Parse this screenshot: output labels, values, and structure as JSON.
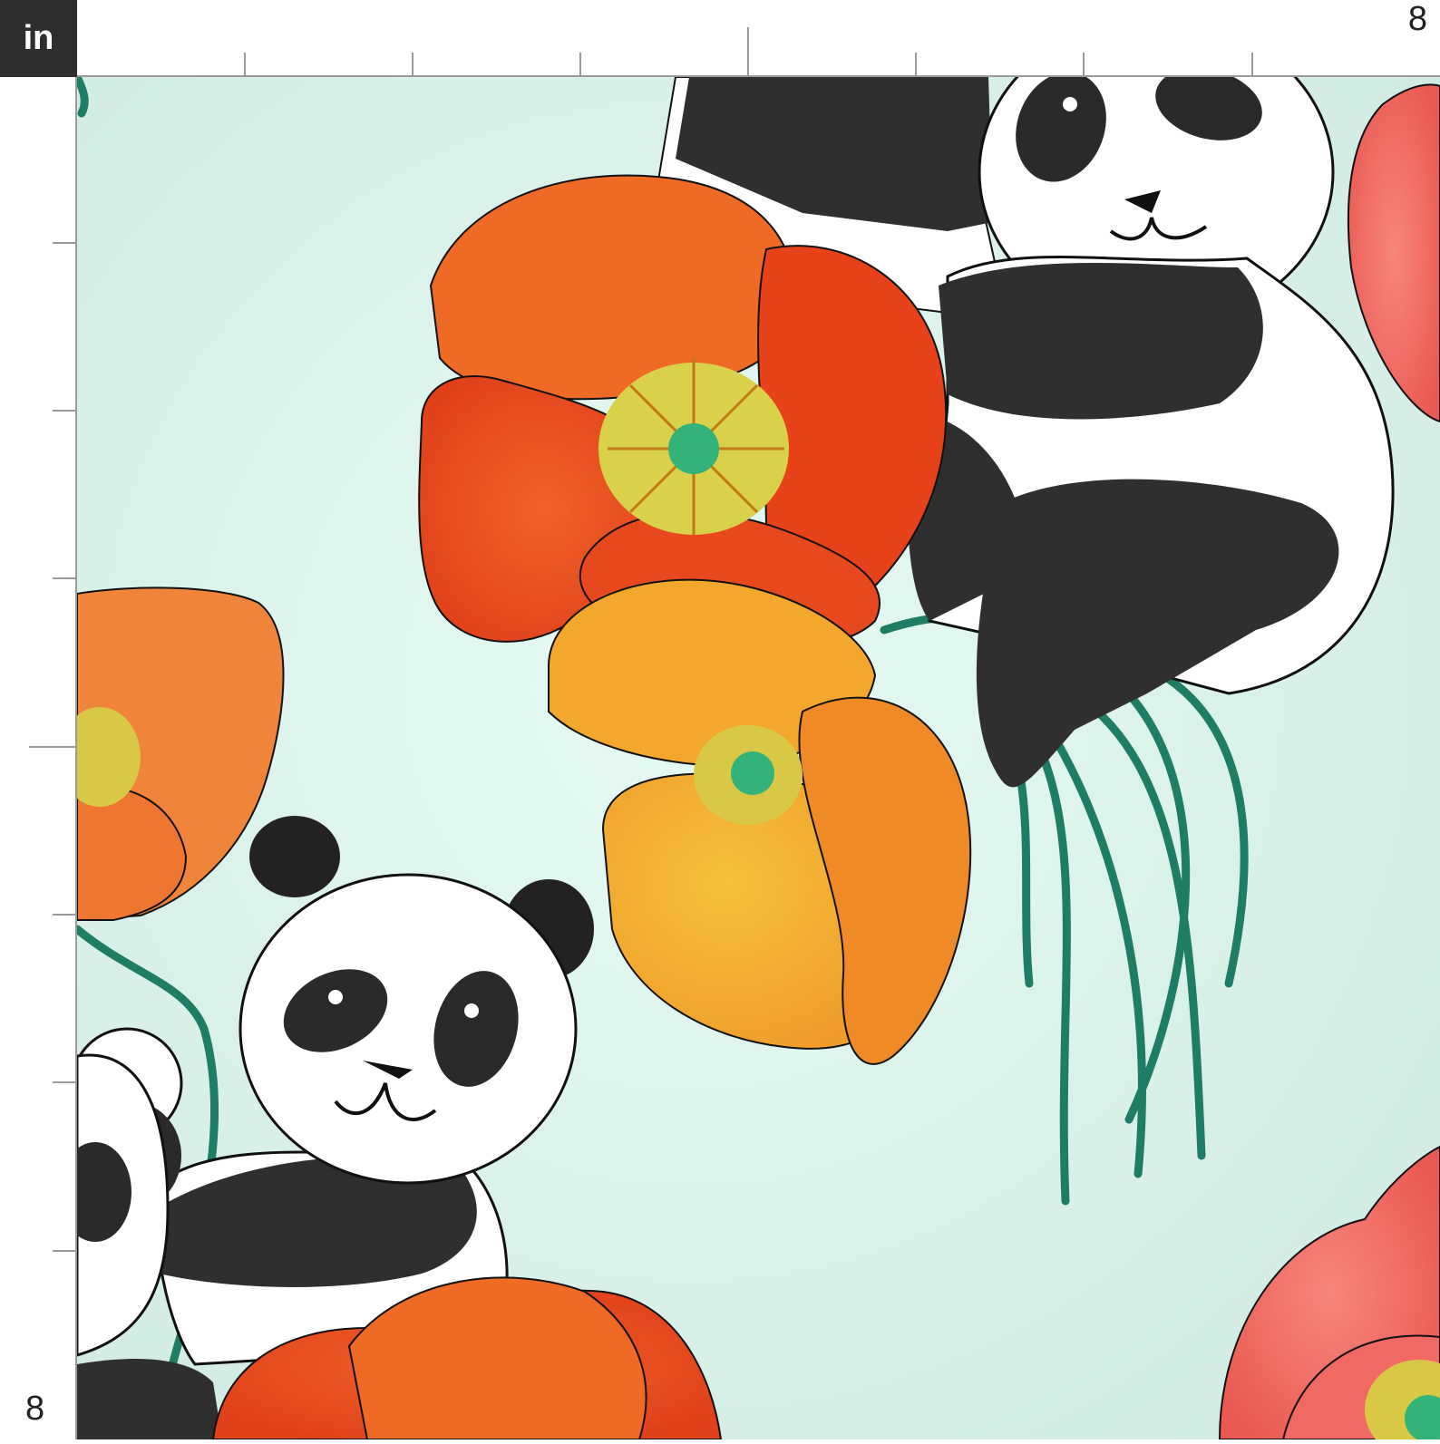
{
  "ruler": {
    "unit_label": "in",
    "top_end_label": "8",
    "left_end_label": "8"
  },
  "fabric": {
    "background_color": "#e1f6ef",
    "motifs": [
      "panda",
      "poppy"
    ],
    "poppy_colors": [
      "#e8481e",
      "#f19a2c",
      "#f3b72e",
      "#f06a63"
    ],
    "panda_colors": [
      "#2f2f2f",
      "#ffffff"
    ],
    "stem_color": "#1f7d63"
  },
  "icons": {
    "unit": "inch-unit-label",
    "ruler": "ruler-ticks"
  }
}
